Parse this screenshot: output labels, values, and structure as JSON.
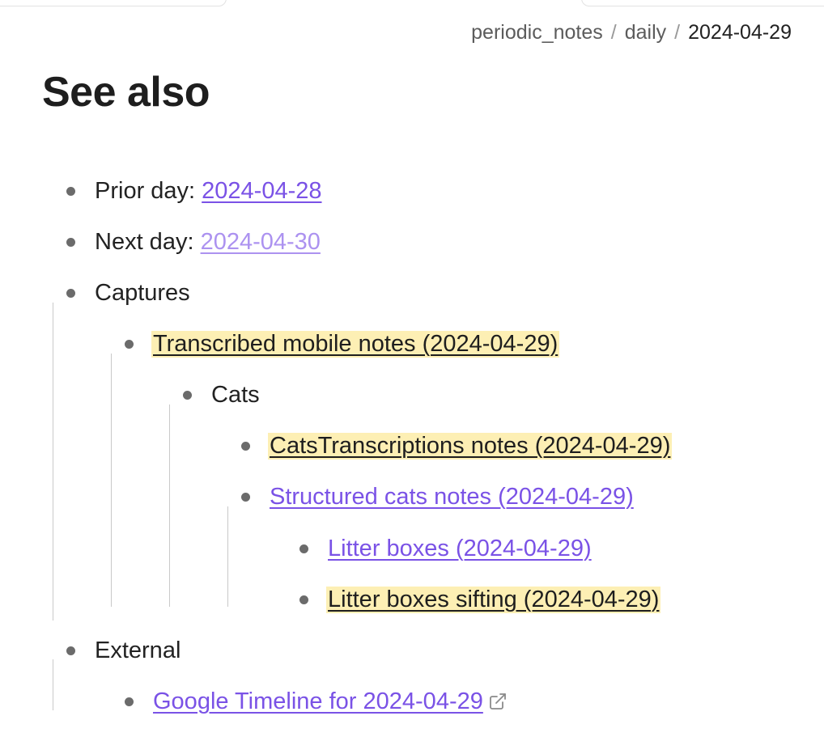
{
  "breadcrumb": {
    "root": "periodic_notes",
    "folder": "daily",
    "current": "2024-04-29",
    "separator": "/"
  },
  "title": "See also",
  "items": {
    "prior_label": "Prior day:",
    "prior_link": "2024-04-28",
    "next_label": "Next day:",
    "next_link": "2024-04-30",
    "captures": "Captures",
    "transcribed": "Transcribed mobile notes (2024-04-29)",
    "cats": "Cats",
    "cats_transcriptions": "CatsTranscriptions notes (2024-04-29)",
    "structured_cats": "Structured cats notes (2024-04-29)",
    "litter_boxes": "Litter boxes (2024-04-29)",
    "litter_boxes_sifting": "Litter boxes sifting (2024-04-29)",
    "external": "External",
    "google_timeline": "Google Timeline for 2024-04-29"
  },
  "icons": {
    "external_link": "external-link-icon"
  },
  "colors": {
    "link": "#7a52e6",
    "unresolved_link": "#ac92f0",
    "highlight": "#fdefb4",
    "bullet": "#6b6b6b",
    "guide": "#c9c9c9"
  }
}
